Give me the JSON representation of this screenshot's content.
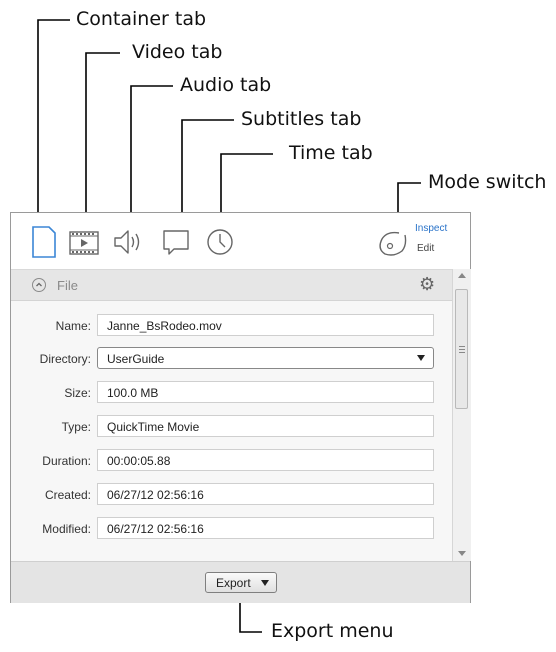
{
  "callouts": {
    "container_tab": "Container tab",
    "video_tab": "Video tab",
    "audio_tab": "Audio tab",
    "subtitles_tab": "Subtitles tab",
    "time_tab": "Time tab",
    "mode_switch": "Mode switch",
    "export_menu": "Export menu"
  },
  "toolbar": {
    "tabs": [
      {
        "icon": "document-icon"
      },
      {
        "icon": "film-icon"
      },
      {
        "icon": "speaker-icon"
      },
      {
        "icon": "speech-bubble-icon"
      },
      {
        "icon": "clock-icon"
      }
    ],
    "mode_switch": {
      "inspect_label": "Inspect",
      "edit_label": "Edit",
      "icon": "disc-icon"
    }
  },
  "section": {
    "title": "File",
    "collapse_icon": "chevron-up-icon",
    "settings_icon": "gear-icon"
  },
  "fields": [
    {
      "label": "Name:",
      "value": "Janne_BsRodeo.mov"
    },
    {
      "label": "Directory:",
      "value": "UserGuide"
    },
    {
      "label": "Size:",
      "value": "100.0 MB"
    },
    {
      "label": "Type:",
      "value": "QuickTime Movie"
    },
    {
      "label": "Duration:",
      "value": "00:00:05.88"
    },
    {
      "label": "Created:",
      "value": "06/27/12 02:56:16"
    },
    {
      "label": "Modified:",
      "value": "06/27/12 02:56:16"
    }
  ],
  "footer": {
    "export_label": "Export"
  },
  "colors": {
    "accent": "#2a73c9",
    "panel_border": "#9a9a9a",
    "footer_bg": "#e4e4e4"
  }
}
